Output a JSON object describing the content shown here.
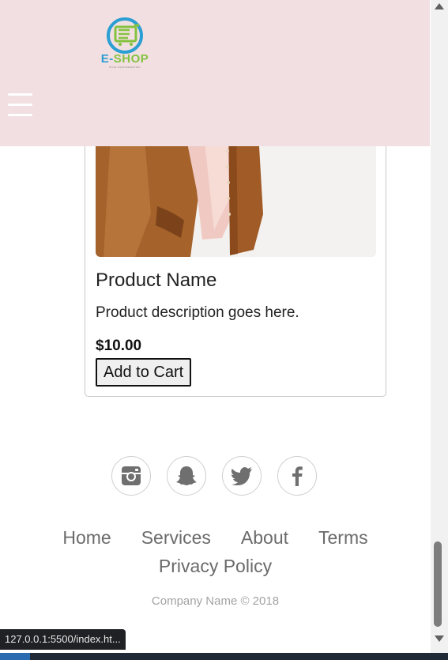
{
  "logo": {
    "brand_prefix": "E-",
    "brand_suffix": "SHOP",
    "tagline": "STYLE YOUR FASHION WAY"
  },
  "product": {
    "name": "Product Name",
    "description": "Product description goes here.",
    "price": "$10.00",
    "add_label": "Add to Cart"
  },
  "social": [
    {
      "icon": "instagram-icon"
    },
    {
      "icon": "snapchat-icon"
    },
    {
      "icon": "twitter-icon"
    },
    {
      "icon": "facebook-icon"
    }
  ],
  "footer": {
    "links": [
      "Home",
      "Services",
      "About",
      "Terms",
      "Privacy Policy"
    ],
    "copyright": "Company Name © 2018"
  },
  "status_url": "127.0.0.1:5500/index.ht...",
  "colors": {
    "header_bg": "#f2dfe1",
    "brand_blue": "#2b9fd3",
    "brand_green": "#86c241",
    "footer_text": "#6b6b6b"
  }
}
